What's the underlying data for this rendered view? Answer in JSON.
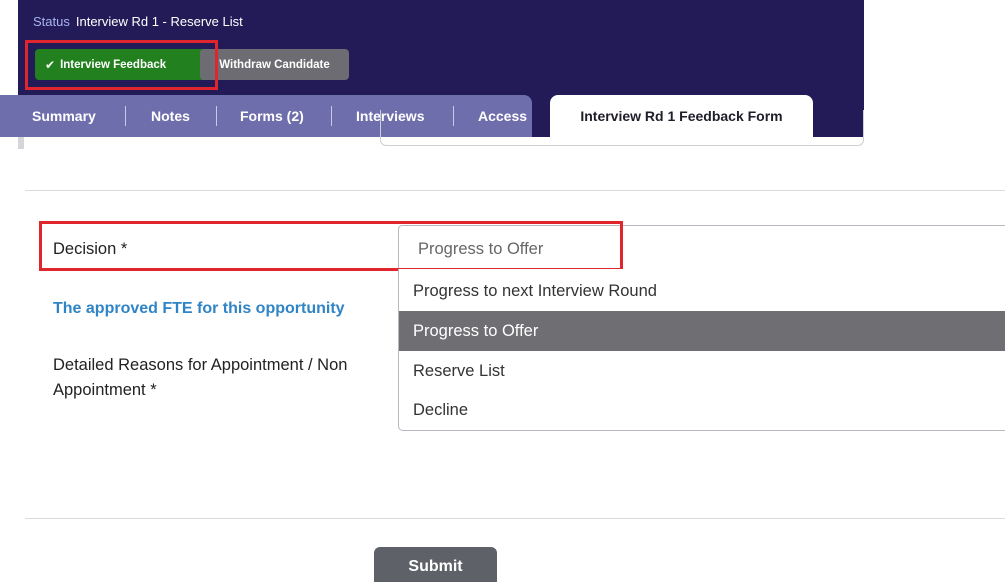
{
  "header": {
    "status_key": "Status",
    "status_value": "Interview Rd 1 - Reserve List",
    "feedback_label": "Interview Feedback",
    "withdraw_label": "Withdraw Candidate",
    "colors": {
      "panel": "#231b58",
      "feedback": "#23801f",
      "withdraw": "#6c6c72",
      "tabs": "#6f6ead",
      "highlight": "#e0262c"
    }
  },
  "tabs": [
    {
      "label": "Summary"
    },
    {
      "label": "Notes"
    },
    {
      "label": "Forms (2)"
    },
    {
      "label": "Interviews"
    },
    {
      "label": "Access"
    },
    {
      "label": "Interview Rd 1 Feedback Form",
      "active": true
    }
  ],
  "form": {
    "decision_label": "Decision *",
    "decision_value": "Progress to Offer",
    "fte_text": "The approved FTE for this opportunity",
    "reasons_label": "Detailed Reasons for Appointment / Non Appointment *",
    "options": [
      {
        "label": "Progress to next Interview Round",
        "selected": false
      },
      {
        "label": "Progress to Offer",
        "selected": true
      },
      {
        "label": "Reserve List",
        "selected": false
      },
      {
        "label": "Decline",
        "selected": false
      }
    ],
    "submit_label": "Submit"
  },
  "icons": {
    "feedback": "check-icon"
  }
}
